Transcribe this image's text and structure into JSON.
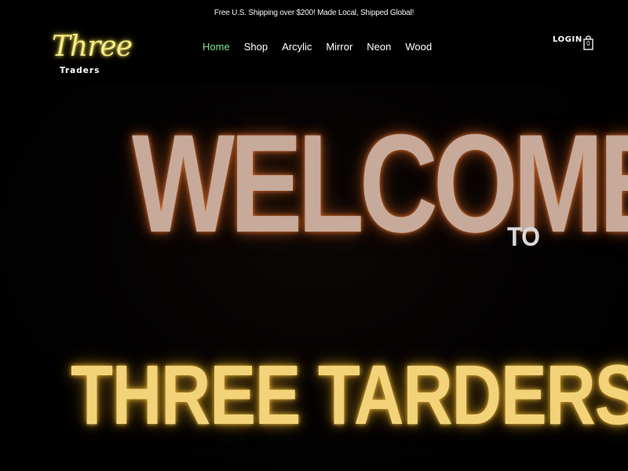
{
  "announcement": "Free U.S. Shipping over $200! Made Local, Shipped Global!",
  "logo": {
    "script": "Three",
    "sub": "Traders"
  },
  "nav": {
    "items": [
      {
        "label": "Home",
        "active": true
      },
      {
        "label": "Shop",
        "active": false
      },
      {
        "label": "Arcylic",
        "active": false
      },
      {
        "label": "Mirror",
        "active": false
      },
      {
        "label": "Neon",
        "active": false
      },
      {
        "label": "Wood",
        "active": false
      }
    ]
  },
  "account": {
    "login_label": "LOGIN",
    "cart_count": "0",
    "cart_icon": "shopping-bag-icon"
  },
  "hero": {
    "line1": "WELCOME",
    "line1_suffix": "TO",
    "line2": "THREE TARDERS"
  },
  "colors": {
    "background": "#000000",
    "nav_active": "#7ee08a",
    "logo_glow": "#f7ec88",
    "welcome_text": "#c7aa9a",
    "welcome_glow": "#e07830",
    "three_traders_text": "#f3d37a"
  }
}
